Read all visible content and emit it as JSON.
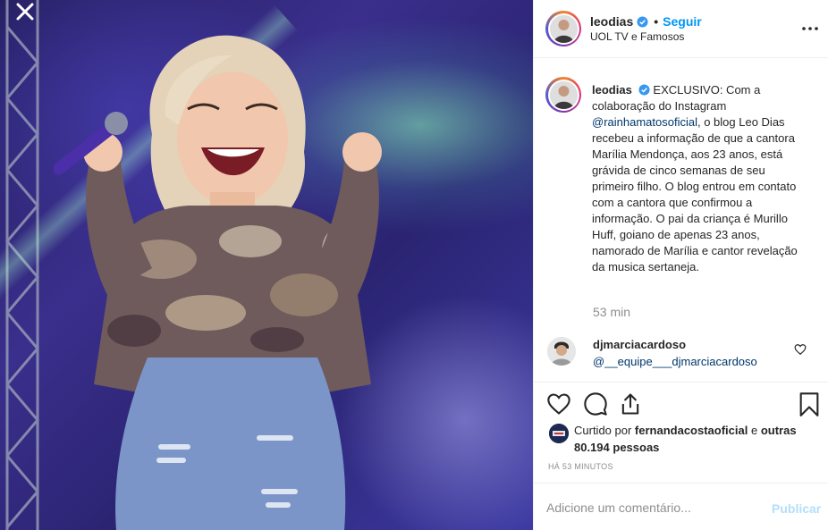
{
  "post": {
    "username": "leodias",
    "follow_label": "Seguir",
    "dot": "•",
    "location": "UOL TV e Famosos",
    "caption_prefix": "EXCLUSIVO: Com a colaboração do Instagram ",
    "caption_mention": "@rainhamatosoficial",
    "caption_suffix": ", o blog Leo Dias recebeu a informação de que a cantora Marília Mendonça, aos 23 anos, está grávida de cinco semanas de seu primeiro filho. O blog entrou em contato com a cantora que confirmou a informação. O pai da criança é Murillo Huff, goiano de apenas 23 anos, namorado de Marília e cantor revelação da musica sertaneja.",
    "caption_time": "53 min"
  },
  "comment": {
    "username": "djmarciacardoso",
    "text": "@__equipe___djmarciacardoso"
  },
  "likes": {
    "prefix": "Curtido por ",
    "liker": "fernandacostaoficial",
    "middle": " e ",
    "others": "outras 80.194 pessoas"
  },
  "timestamp": "HÁ 53 MINUTOS",
  "add_comment": {
    "placeholder": "Adicione um comentário...",
    "post_label": "Publicar"
  },
  "icons": {
    "close": "close-icon",
    "verified": "verified-badge-icon",
    "more": "more-options-icon",
    "like": "heart-icon",
    "comment": "comment-icon",
    "share": "share-icon",
    "save": "bookmark-icon"
  },
  "colors": {
    "link": "#0095f6",
    "mention": "#00376b",
    "muted": "#8e8e8e",
    "post_disabled": "#b2dffc"
  }
}
